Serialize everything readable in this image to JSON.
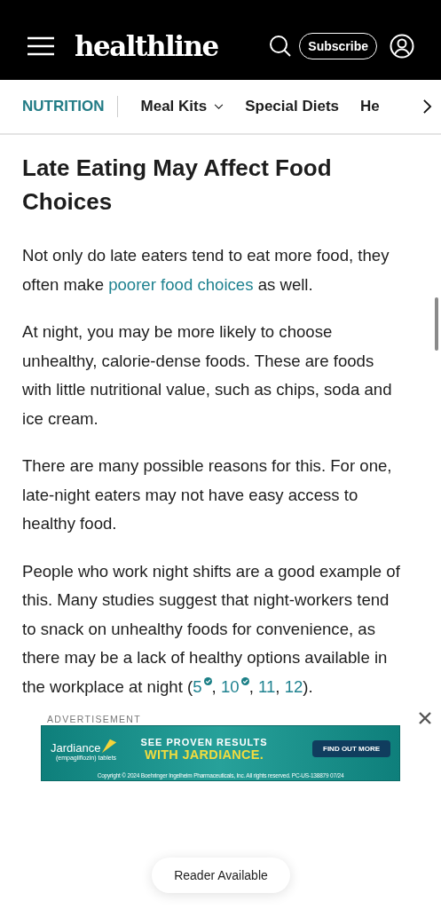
{
  "header": {
    "logo": "healthline",
    "subscribe": "Subscribe"
  },
  "nav": {
    "section": "NUTRITION",
    "items": [
      {
        "label": "Meal Kits",
        "dropdown": true
      },
      {
        "label": "Special Diets",
        "dropdown": false
      },
      {
        "label": "He",
        "dropdown": false
      }
    ]
  },
  "article": {
    "heading": "Late Eating May Affect Food Choices",
    "paragraphs": [
      [
        {
          "kind": "text",
          "text": "Not only do late eaters tend to eat more food, they often make "
        },
        {
          "kind": "link",
          "text": "poorer food choices"
        },
        {
          "kind": "text",
          "text": " as well."
        }
      ],
      [
        {
          "kind": "text",
          "text": "At night, you may be more likely to choose unhealthy, calorie-dense foods. These are foods with little nutritional value, such as chips, soda and ice cream."
        }
      ],
      [
        {
          "kind": "text",
          "text": "There are many possible reasons for this. For one, late-night eaters may not have easy access to healthy food."
        }
      ],
      [
        {
          "kind": "text",
          "text": "People who work night shifts are a good example of this. Many studies suggest that night-workers tend to snack on unhealthy foods for convenience, as there may be a lack of healthy options available in the workplace at night ("
        },
        {
          "kind": "citation",
          "text": "5",
          "verified": true
        },
        {
          "kind": "text",
          "text": ", "
        },
        {
          "kind": "citation",
          "text": "10",
          "verified": true
        },
        {
          "kind": "text",
          "text": ", "
        },
        {
          "kind": "citation",
          "text": "11",
          "verified": false
        },
        {
          "kind": "text",
          "text": ", "
        },
        {
          "kind": "citation",
          "text": "12",
          "verified": false
        },
        {
          "kind": "text",
          "text": ")."
        }
      ]
    ]
  },
  "ad": {
    "label": "ADVERTISEMENT",
    "brand": "Jardiance",
    "brand_sub": "(empagliflozin) tablets",
    "headline_1": "SEE PROVEN RESULTS",
    "headline_2": "WITH JARDIANCE.",
    "button": "FIND OUT MORE",
    "copyright": "Copyright © 2024 Boehringer Ingelheim Pharmaceuticals, Inc. All rights reserved. PC-US-138879 07/24"
  },
  "reader_button": "Reader Available"
}
